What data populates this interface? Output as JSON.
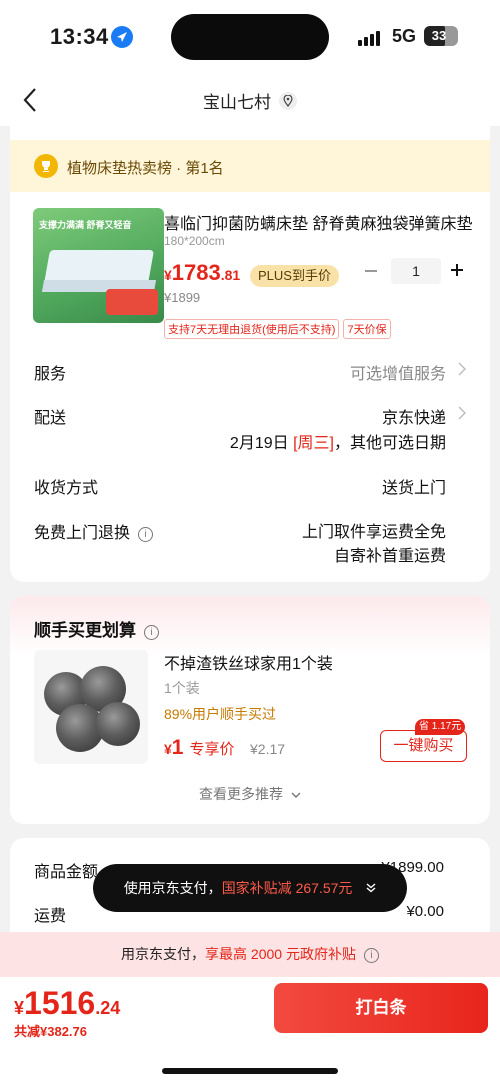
{
  "status": {
    "time": "13:34",
    "network": "5G",
    "battery": "33"
  },
  "nav": {
    "back_icon": "chevron-left-icon",
    "title": "宝山七村"
  },
  "rank": {
    "text": "植物床垫热卖榜 · 第1名"
  },
  "product": {
    "image_headline": "支撑力满满 舒脊又轻音",
    "title": "喜临门抑菌防螨床垫 舒脊黄麻独袋弹簧床垫",
    "spec": "180*200cm",
    "price_symbol": "¥",
    "price_int": "1783",
    "price_dec": ".81",
    "plus_tag": "PLUS到手价",
    "quantity": "1",
    "original_price": "¥1899",
    "tags": [
      "支持7天无理由退货(使用后不支持)",
      "7天价保"
    ]
  },
  "details": {
    "service": {
      "label": "服务",
      "value": "可选增值服务"
    },
    "delivery": {
      "label": "配送",
      "value": "京东快递",
      "date_prefix": "2月19日 ",
      "date_day": "[周三]",
      "date_suffix": "，其他可选日期"
    },
    "receive": {
      "label": "收货方式",
      "value": "送货上门"
    },
    "free_return": {
      "label": "免费上门退换",
      "line1": "上门取件享运费全免",
      "line2": "自寄补首重运费"
    }
  },
  "addon": {
    "title": "顺手买更划算",
    "item_title": "不掉渣铁丝球家用1个装",
    "item_spec": "1个装",
    "item_stat": "89%用户顺手买过",
    "price_symbol": "¥",
    "price_int": "1",
    "price_label": "专享价",
    "original_price": "¥2.17",
    "save_tag": "省 1.17元",
    "buy_label": "一键购买",
    "more_label": "查看更多推荐"
  },
  "summary": {
    "goods_label": "商品金额",
    "goods_value": "¥1899.00",
    "shipping_label": "运费",
    "shipping_value": "¥0.00"
  },
  "toast": {
    "prefix": "使用京东支付，",
    "highlight": "国家补贴减 267.57元"
  },
  "subsidy": {
    "prefix": "用京东支付，",
    "highlight": "享最高 2000 元政府补贴"
  },
  "bottom": {
    "total_symbol": "¥",
    "total_int": "1516",
    "total_dec": ".24",
    "discount": "共减¥382.76",
    "pay_label": "打白条"
  }
}
